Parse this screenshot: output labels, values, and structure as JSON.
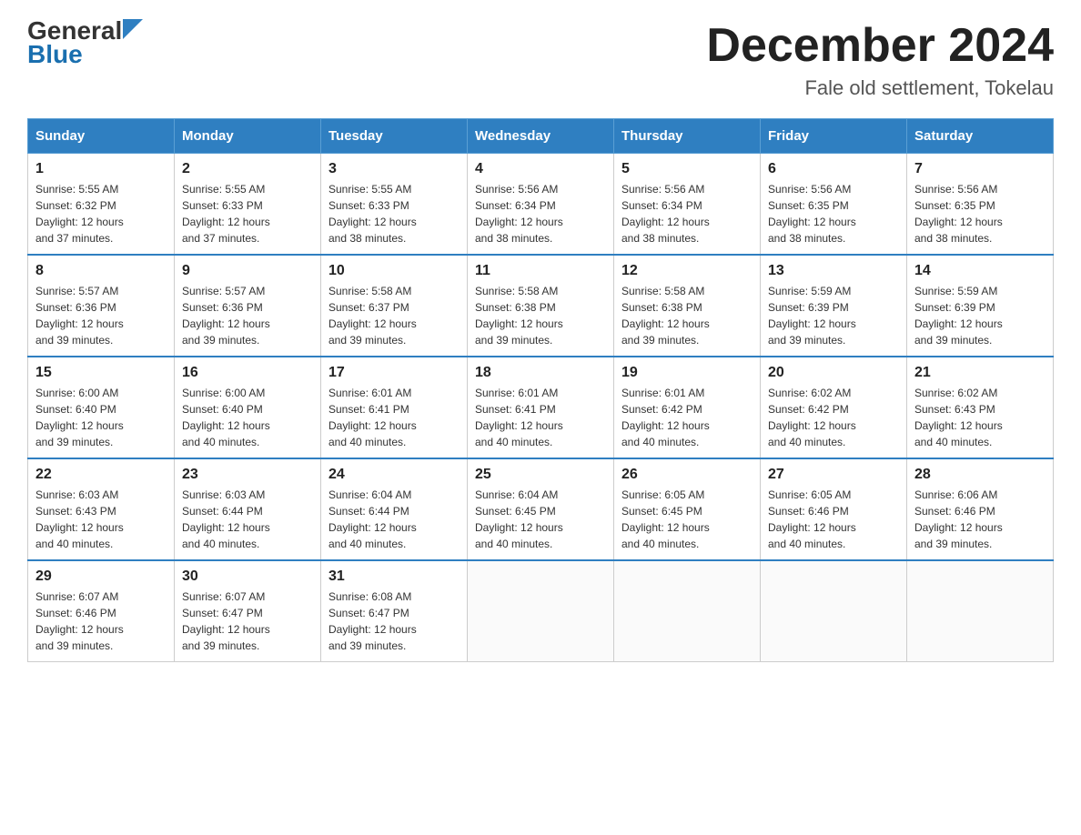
{
  "header": {
    "logo_general": "General",
    "logo_blue": "Blue",
    "month_title": "December 2024",
    "location": "Fale old settlement, Tokelau"
  },
  "days_of_week": [
    "Sunday",
    "Monday",
    "Tuesday",
    "Wednesday",
    "Thursday",
    "Friday",
    "Saturday"
  ],
  "weeks": [
    [
      {
        "day": "1",
        "sunrise": "5:55 AM",
        "sunset": "6:32 PM",
        "daylight": "12 hours and 37 minutes."
      },
      {
        "day": "2",
        "sunrise": "5:55 AM",
        "sunset": "6:33 PM",
        "daylight": "12 hours and 37 minutes."
      },
      {
        "day": "3",
        "sunrise": "5:55 AM",
        "sunset": "6:33 PM",
        "daylight": "12 hours and 38 minutes."
      },
      {
        "day": "4",
        "sunrise": "5:56 AM",
        "sunset": "6:34 PM",
        "daylight": "12 hours and 38 minutes."
      },
      {
        "day": "5",
        "sunrise": "5:56 AM",
        "sunset": "6:34 PM",
        "daylight": "12 hours and 38 minutes."
      },
      {
        "day": "6",
        "sunrise": "5:56 AM",
        "sunset": "6:35 PM",
        "daylight": "12 hours and 38 minutes."
      },
      {
        "day": "7",
        "sunrise": "5:56 AM",
        "sunset": "6:35 PM",
        "daylight": "12 hours and 38 minutes."
      }
    ],
    [
      {
        "day": "8",
        "sunrise": "5:57 AM",
        "sunset": "6:36 PM",
        "daylight": "12 hours and 39 minutes."
      },
      {
        "day": "9",
        "sunrise": "5:57 AM",
        "sunset": "6:36 PM",
        "daylight": "12 hours and 39 minutes."
      },
      {
        "day": "10",
        "sunrise": "5:58 AM",
        "sunset": "6:37 PM",
        "daylight": "12 hours and 39 minutes."
      },
      {
        "day": "11",
        "sunrise": "5:58 AM",
        "sunset": "6:38 PM",
        "daylight": "12 hours and 39 minutes."
      },
      {
        "day": "12",
        "sunrise": "5:58 AM",
        "sunset": "6:38 PM",
        "daylight": "12 hours and 39 minutes."
      },
      {
        "day": "13",
        "sunrise": "5:59 AM",
        "sunset": "6:39 PM",
        "daylight": "12 hours and 39 minutes."
      },
      {
        "day": "14",
        "sunrise": "5:59 AM",
        "sunset": "6:39 PM",
        "daylight": "12 hours and 39 minutes."
      }
    ],
    [
      {
        "day": "15",
        "sunrise": "6:00 AM",
        "sunset": "6:40 PM",
        "daylight": "12 hours and 39 minutes."
      },
      {
        "day": "16",
        "sunrise": "6:00 AM",
        "sunset": "6:40 PM",
        "daylight": "12 hours and 40 minutes."
      },
      {
        "day": "17",
        "sunrise": "6:01 AM",
        "sunset": "6:41 PM",
        "daylight": "12 hours and 40 minutes."
      },
      {
        "day": "18",
        "sunrise": "6:01 AM",
        "sunset": "6:41 PM",
        "daylight": "12 hours and 40 minutes."
      },
      {
        "day": "19",
        "sunrise": "6:01 AM",
        "sunset": "6:42 PM",
        "daylight": "12 hours and 40 minutes."
      },
      {
        "day": "20",
        "sunrise": "6:02 AM",
        "sunset": "6:42 PM",
        "daylight": "12 hours and 40 minutes."
      },
      {
        "day": "21",
        "sunrise": "6:02 AM",
        "sunset": "6:43 PM",
        "daylight": "12 hours and 40 minutes."
      }
    ],
    [
      {
        "day": "22",
        "sunrise": "6:03 AM",
        "sunset": "6:43 PM",
        "daylight": "12 hours and 40 minutes."
      },
      {
        "day": "23",
        "sunrise": "6:03 AM",
        "sunset": "6:44 PM",
        "daylight": "12 hours and 40 minutes."
      },
      {
        "day": "24",
        "sunrise": "6:04 AM",
        "sunset": "6:44 PM",
        "daylight": "12 hours and 40 minutes."
      },
      {
        "day": "25",
        "sunrise": "6:04 AM",
        "sunset": "6:45 PM",
        "daylight": "12 hours and 40 minutes."
      },
      {
        "day": "26",
        "sunrise": "6:05 AM",
        "sunset": "6:45 PM",
        "daylight": "12 hours and 40 minutes."
      },
      {
        "day": "27",
        "sunrise": "6:05 AM",
        "sunset": "6:46 PM",
        "daylight": "12 hours and 40 minutes."
      },
      {
        "day": "28",
        "sunrise": "6:06 AM",
        "sunset": "6:46 PM",
        "daylight": "12 hours and 39 minutes."
      }
    ],
    [
      {
        "day": "29",
        "sunrise": "6:07 AM",
        "sunset": "6:46 PM",
        "daylight": "12 hours and 39 minutes."
      },
      {
        "day": "30",
        "sunrise": "6:07 AM",
        "sunset": "6:47 PM",
        "daylight": "12 hours and 39 minutes."
      },
      {
        "day": "31",
        "sunrise": "6:08 AM",
        "sunset": "6:47 PM",
        "daylight": "12 hours and 39 minutes."
      },
      null,
      null,
      null,
      null
    ]
  ],
  "labels": {
    "sunrise_prefix": "Sunrise: ",
    "sunset_prefix": "Sunset: ",
    "daylight_prefix": "Daylight: "
  }
}
